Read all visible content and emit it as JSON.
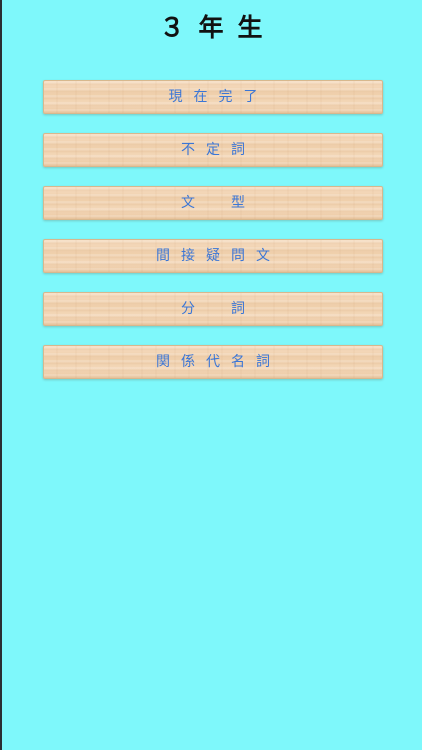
{
  "header": {
    "title": "３年生"
  },
  "menu": {
    "items": [
      {
        "label": "現在完了"
      },
      {
        "label": "不定詞"
      },
      {
        "label": "文　型"
      },
      {
        "label": "間接疑問文"
      },
      {
        "label": "分　詞"
      },
      {
        "label": "関係代名詞"
      }
    ]
  },
  "colors": {
    "background": "#7ef8fb",
    "button_text": "#3b76d6",
    "title_text": "#111111"
  }
}
